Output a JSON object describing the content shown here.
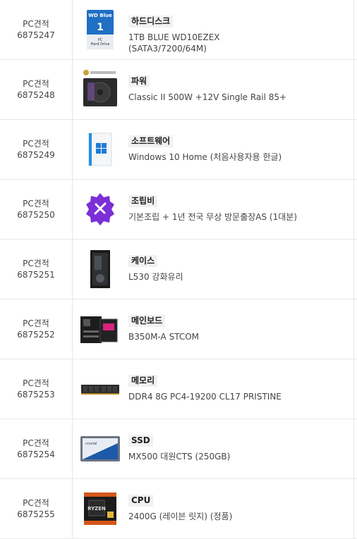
{
  "rows": [
    {
      "id_label": "PC견적",
      "id_number": "6875247",
      "category": "하드디스크",
      "description": "1TB BLUE WD10EZEX (SATA3/7200/64M)",
      "image_icon": "hard-drive-icon"
    },
    {
      "id_label": "PC견적",
      "id_number": "6875248",
      "category": "파워",
      "description": "Classic II 500W +12V Single Rail 85+",
      "image_icon": "power-supply-icon"
    },
    {
      "id_label": "PC견적",
      "id_number": "6875249",
      "category": "소프트웨어",
      "description": "Windows 10 Home (처음사용자용 한글)",
      "image_icon": "windows-box-icon"
    },
    {
      "id_label": "PC견적",
      "id_number": "6875250",
      "category": "조립비",
      "description": "기본조립 + 1년 전국 무상 방문출장AS (1대분)",
      "image_icon": "assembly-service-icon"
    },
    {
      "id_label": "PC견적",
      "id_number": "6875251",
      "category": "케이스",
      "description": "L530 강화유리",
      "image_icon": "pc-case-icon"
    },
    {
      "id_label": "PC견적",
      "id_number": "6875252",
      "category": "메인보드",
      "description": "B350M-A STCOM",
      "image_icon": "motherboard-icon"
    },
    {
      "id_label": "PC견적",
      "id_number": "6875253",
      "category": "메모리",
      "description": "DDR4 8G PC4-19200 CL17 PRISTINE",
      "image_icon": "memory-stick-icon"
    },
    {
      "id_label": "PC견적",
      "id_number": "6875254",
      "category": "SSD",
      "description": "MX500 대원CTS (250GB)",
      "image_icon": "ssd-icon"
    },
    {
      "id_label": "PC견적",
      "id_number": "6875255",
      "category": "CPU",
      "description": "2400G (레이븐 릿지) (정품)",
      "image_icon": "cpu-box-icon"
    }
  ]
}
